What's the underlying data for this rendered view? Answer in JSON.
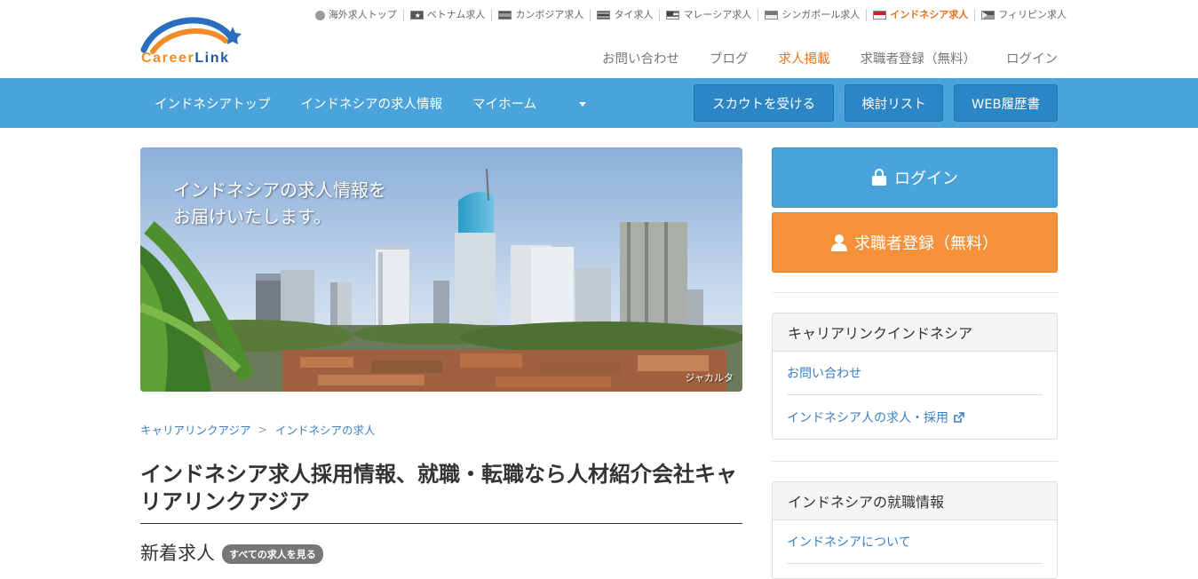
{
  "header": {
    "logo": {
      "career": "Career",
      "link": "Link"
    },
    "countries": [
      {
        "label": "海外求人トップ",
        "icon": "globe-icon",
        "active": false
      },
      {
        "label": "ベトナム求人",
        "icon": "vietnam-flag-icon",
        "active": false
      },
      {
        "label": "カンボジア求人",
        "icon": "cambodia-flag-icon",
        "active": false
      },
      {
        "label": "タイ求人",
        "icon": "thailand-flag-icon",
        "active": false
      },
      {
        "label": "マレーシア求人",
        "icon": "malaysia-flag-icon",
        "active": false
      },
      {
        "label": "シンガポール求人",
        "icon": "singapore-flag-icon",
        "active": false
      },
      {
        "label": "インドネシア求人",
        "icon": "indonesia-flag-icon",
        "active": true
      },
      {
        "label": "フィリピン求人",
        "icon": "philippines-flag-icon",
        "active": false
      }
    ],
    "top_nav": {
      "contact": "お問い合わせ",
      "blog": "ブログ",
      "post_job": "求人掲載",
      "register": "求職者登録（無料）",
      "login": "ログイン"
    }
  },
  "main_nav": {
    "top": "インドネシアトップ",
    "jobs": "インドネシアの求人情報",
    "myhome": "マイホーム",
    "scout_button": "スカウトを受ける",
    "watchlist_button": "検討リスト",
    "resume_button": "WEB履歴書"
  },
  "hero": {
    "caption_line1": "インドネシアの求人情報を",
    "caption_line2": "お届けいたします。",
    "credit": "ジャカルタ"
  },
  "breadcrumb": {
    "home": "キャリアリンクアジア",
    "current": "インドネシアの求人"
  },
  "page": {
    "title": "インドネシア求人採用情報、就職・転職なら人材紹介会社キャリアリンクアジア",
    "new_jobs_heading": "新着求人",
    "all_jobs_pill": "すべての求人を見る"
  },
  "sidebar": {
    "login_button": "ログイン",
    "register_button": "求職者登録（無料）",
    "panel1": {
      "title": "キャリアリンクインドネシア",
      "links": [
        "お問い合わせ",
        "インドネシア人の求人・採用"
      ]
    },
    "panel2": {
      "title": "インドネシアの就職情報",
      "links": [
        "インドネシアについて"
      ]
    }
  },
  "colors": {
    "accent_orange": "#f4913a",
    "nav_blue": "#4ba3db",
    "button_blue": "#2c85c4",
    "link_blue": "#3a7fc0"
  }
}
